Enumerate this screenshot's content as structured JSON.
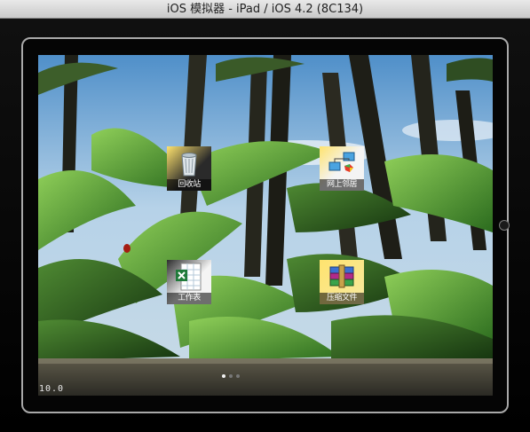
{
  "window": {
    "title": "iOS 模拟器 - iPad / iOS 4.2 (8C134)"
  },
  "screen": {
    "wallpaper": "jungle-palms",
    "icons": [
      {
        "label": "回收站",
        "icon": "recycle-bin-icon"
      },
      {
        "label": "网上邻居",
        "icon": "network-icon"
      },
      {
        "label": "工作表",
        "icon": "excel-spreadsheet-icon"
      },
      {
        "label": "压缩文件",
        "icon": "winrar-archive-icon"
      }
    ],
    "page_indicator": {
      "pages": 3,
      "current": 1
    },
    "version_text": "10.0"
  },
  "colors": {
    "titlebar": "#d4d4d4",
    "frame_border": "#a9a9a9",
    "caption_bg": "#000000"
  }
}
